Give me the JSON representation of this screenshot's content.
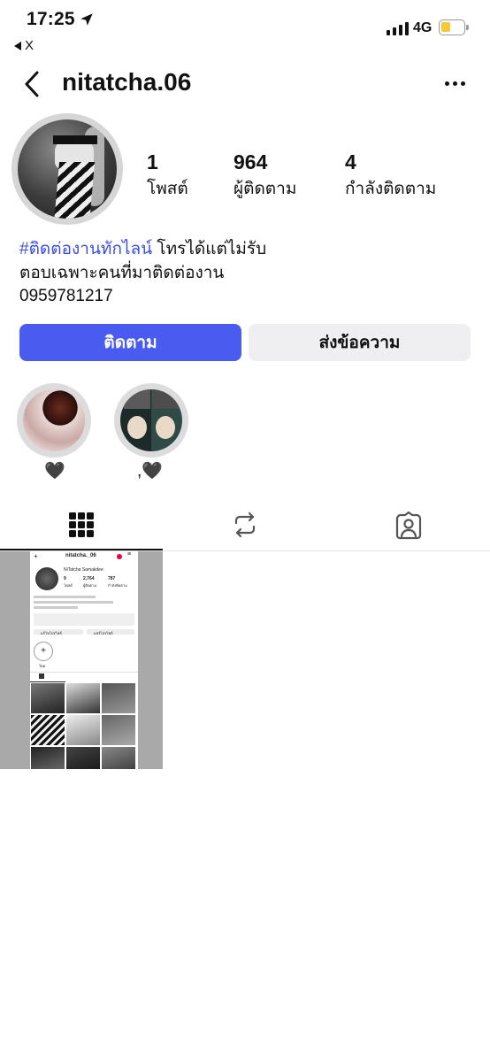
{
  "status_bar": {
    "time": "17:25",
    "back_app_label": "X",
    "network": "4G",
    "battery_color": "#f6c93b",
    "icons": [
      "location-arrow-icon",
      "signal-bars-icon",
      "battery-icon"
    ]
  },
  "header": {
    "username": "nitatcha.06",
    "icons": [
      "chevron-left-icon",
      "more-horizontal-icon"
    ]
  },
  "stats": {
    "posts": {
      "count": "1",
      "label": "โพสต์"
    },
    "followers": {
      "count": "964",
      "label": "ผู้ติดตาม"
    },
    "following": {
      "count": "4",
      "label": "กำลังติดตาม"
    }
  },
  "bio": {
    "hashtag": "#ติดต่องานทักไลน์",
    "line1_rest": " โทรได้แต่ไม่รับ",
    "line2": "ตอบเฉพาะคนที่มาติดต่องาน",
    "line3": "0959781217"
  },
  "buttons": {
    "follow": "ติดตาม",
    "message": "ส่งข้อความ",
    "follow_color": "#4a5cf0"
  },
  "highlights": [
    {
      "label": "🖤"
    },
    {
      "label": ",🖤"
    }
  ],
  "tabs": {
    "icons": [
      "grid-icon",
      "reposts-icon",
      "tagged-person-icon"
    ]
  },
  "post_thumbnail": {
    "username": "nitatcha._06",
    "display_name": "NiTatcha Samakdee",
    "posts": "9",
    "followers": "2,764",
    "following": "787",
    "posts_label": "โพสต์",
    "followers_label": "ผู้ติดตาม",
    "following_label": "กำลังติดตาม",
    "edit_profile": "แก้ไขโปรไฟล์",
    "share_profile": "แชร์โปรไฟล์",
    "new_label": "ใหม่"
  }
}
